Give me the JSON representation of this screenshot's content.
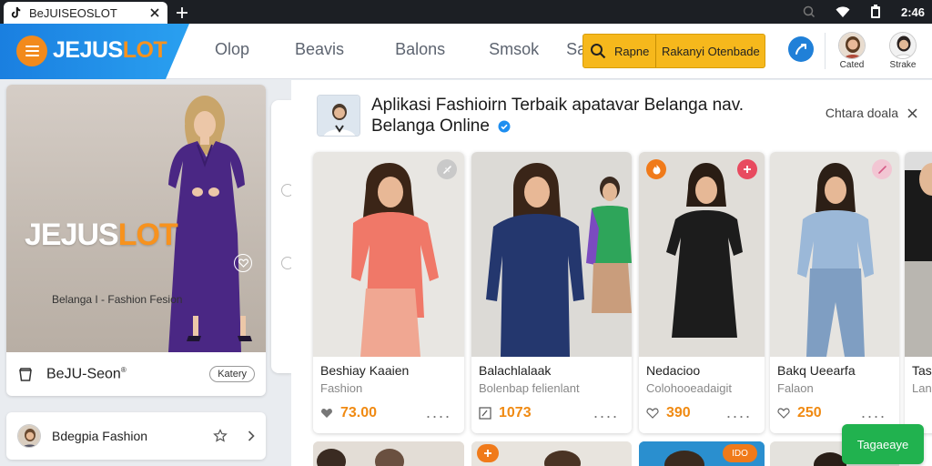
{
  "browser": {
    "tab_title": "BeJUISEOSLOT",
    "status_time": "2:46"
  },
  "app": {
    "brand_main": "JEJUS",
    "brand_accent": "LOT",
    "nav": [
      "Olop",
      "Beavis",
      "Balons",
      "Smsok",
      "Saringu"
    ],
    "search": {
      "field_label": "Rapne",
      "button_label": "Rakanyi Otenbade"
    },
    "users": [
      {
        "name": "Cated"
      },
      {
        "name": "Strake"
      }
    ]
  },
  "hero": {
    "watermark_main": "JEJUS",
    "watermark_accent": "LOT",
    "caption": "Belanga I - Fashion Fesion",
    "title": "BeJU-Seon",
    "title_mark": "®",
    "pill": "Katery"
  },
  "sidebar_row": {
    "label": "Bdegpia Fashion"
  },
  "main": {
    "title": "Aplikasi Fashioirn Terbaik apatavar Belanga nav. Belanga Online",
    "header_action": "Chtara doala",
    "products": [
      {
        "name": "Beshiay Kaaien",
        "sub": "Fashion",
        "price": "73.00",
        "badge_color": "#c9c9c9"
      },
      {
        "name": "Balachlalaak",
        "sub": "Bolenbap felienlant",
        "price": "1073",
        "badge_color": ""
      },
      {
        "name": "Nedacioo",
        "sub": "Colohooeadaigit",
        "price": "390",
        "badge_color": "#f07a1a"
      },
      {
        "name": "Bakq Ueearfa",
        "sub": "Falaon",
        "price": "250",
        "badge_color": "#e84a5f"
      },
      {
        "name": "Tasi",
        "sub": "Lan",
        "price": "",
        "badge_color": ""
      }
    ],
    "bottom_badges": [
      "",
      "",
      "IDO"
    ]
  },
  "fab": {
    "label": "Tagaeaye"
  },
  "colors": {
    "brand_blue": "#1e88e5",
    "accent_orange": "#f7921e",
    "search_yellow": "#f6b81c",
    "fab_green": "#21b24f",
    "price_orange": "#f08a12"
  }
}
